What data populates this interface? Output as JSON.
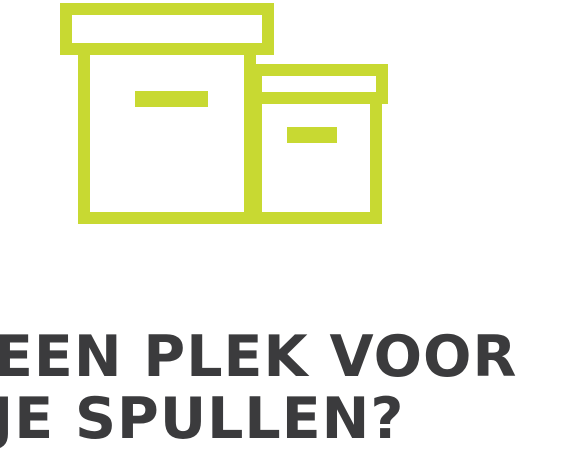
{
  "icon": {
    "name": "storage-boxes-icon",
    "color": "#c8d932"
  },
  "headline": {
    "line1": "EEN PLEK VOOR",
    "line2": "JE SPULLEN?",
    "color": "#3b3b3d"
  }
}
